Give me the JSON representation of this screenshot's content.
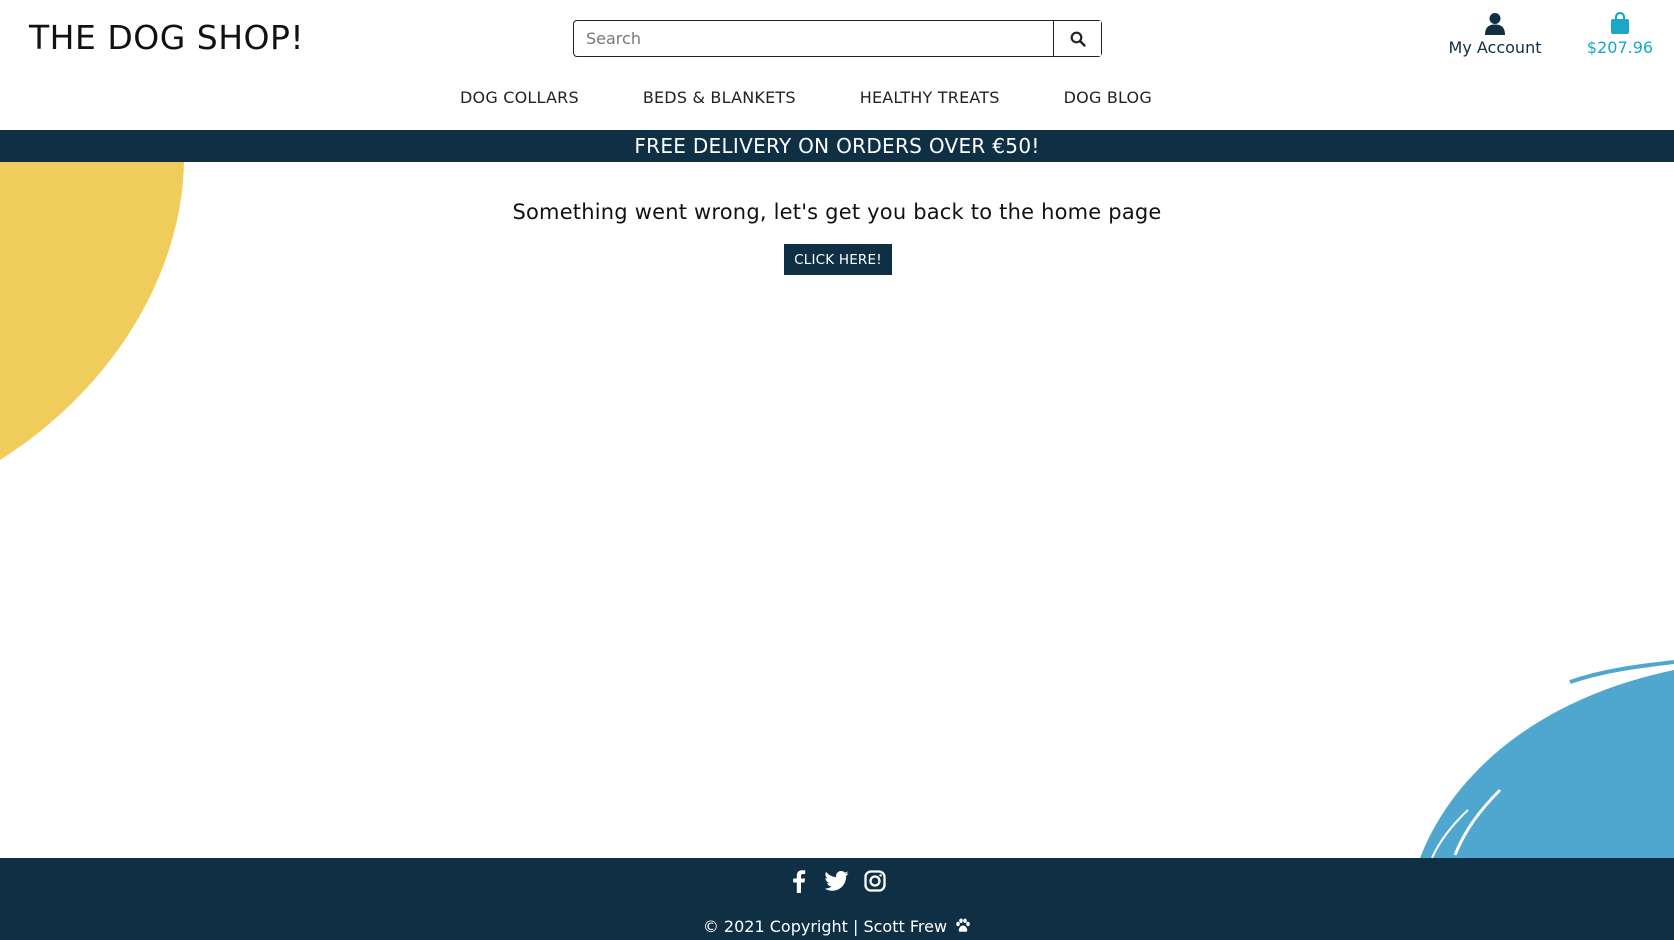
{
  "header": {
    "logo_text": "THE DOG SHOP!",
    "search_placeholder": "Search",
    "account_label": "My Account",
    "cart_total": "$207.96"
  },
  "nav": {
    "items": [
      {
        "label": "DOG COLLARS"
      },
      {
        "label": "BEDS & BLANKETS"
      },
      {
        "label": "HEALTHY TREATS"
      },
      {
        "label": "DOG BLOG"
      }
    ]
  },
  "banner": {
    "text": "FREE DELIVERY ON ORDERS OVER €50!"
  },
  "main": {
    "message": "Something went wrong, let's get you back to the home page",
    "button_label": "CLICK HERE!"
  },
  "footer": {
    "social_icons": [
      "facebook-icon",
      "twitter-icon",
      "instagram-icon"
    ],
    "copyright": "© 2021 Copyright | Scott Frew"
  },
  "colors": {
    "navy": "#0e2f44",
    "accent_cyan": "#1aa7c8",
    "yellow_blob": "#f0cd5a",
    "blue_blob": "#4fa6cf"
  }
}
